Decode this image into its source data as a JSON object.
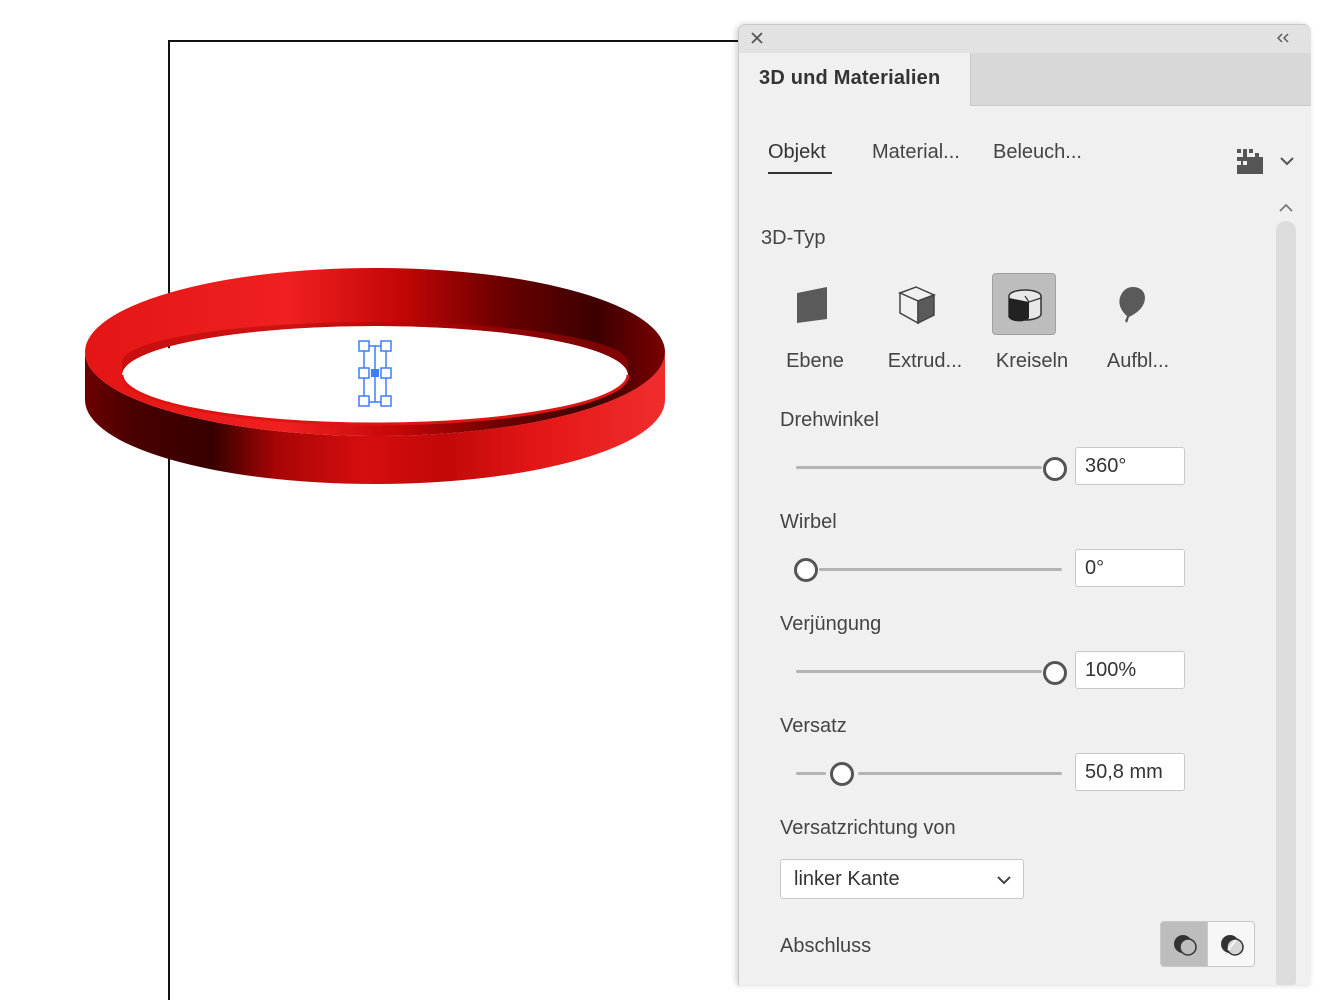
{
  "canvas": {
    "object_name": "rotated ring",
    "ring_color": "#e8191a",
    "selection_color": "#3d7eff"
  },
  "panel": {
    "title": "3D und Materialien",
    "close_icon": "close-icon",
    "collapse_icon": "double-chevron-left-icon",
    "tabs": [
      {
        "label": "Objekt",
        "active": true
      },
      {
        "label": "Material..."
      },
      {
        "label": "Beleuch..."
      }
    ],
    "render_icon": "render-icon",
    "menu_icon": "chevron-down-icon",
    "type_section_label": "3D-Typ",
    "types": [
      {
        "label": "Ebene",
        "icon": "plane-icon"
      },
      {
        "label": "Extrud...",
        "icon": "extrude-icon"
      },
      {
        "label": "Kreiseln",
        "icon": "revolve-icon",
        "selected": true
      },
      {
        "label": "Aufbl...",
        "icon": "inflate-icon"
      }
    ],
    "controls": {
      "drehwinkel": {
        "label": "Drehwinkel",
        "value": "360°",
        "level": 1.0
      },
      "wirbel": {
        "label": "Wirbel",
        "value": "0°",
        "level": 0.0
      },
      "verjuengung": {
        "label": "Verjüngung",
        "value": "100%",
        "level": 1.0
      },
      "versatz": {
        "label": "Versatz",
        "value": "50,8 mm",
        "level": 0.17
      }
    },
    "direction": {
      "label": "Versatzrichtung von",
      "selected": "linker Kante"
    },
    "cap": {
      "label": "Abschluss",
      "options": [
        "cap-on-icon",
        "cap-off-icon"
      ],
      "selected": 0
    }
  }
}
